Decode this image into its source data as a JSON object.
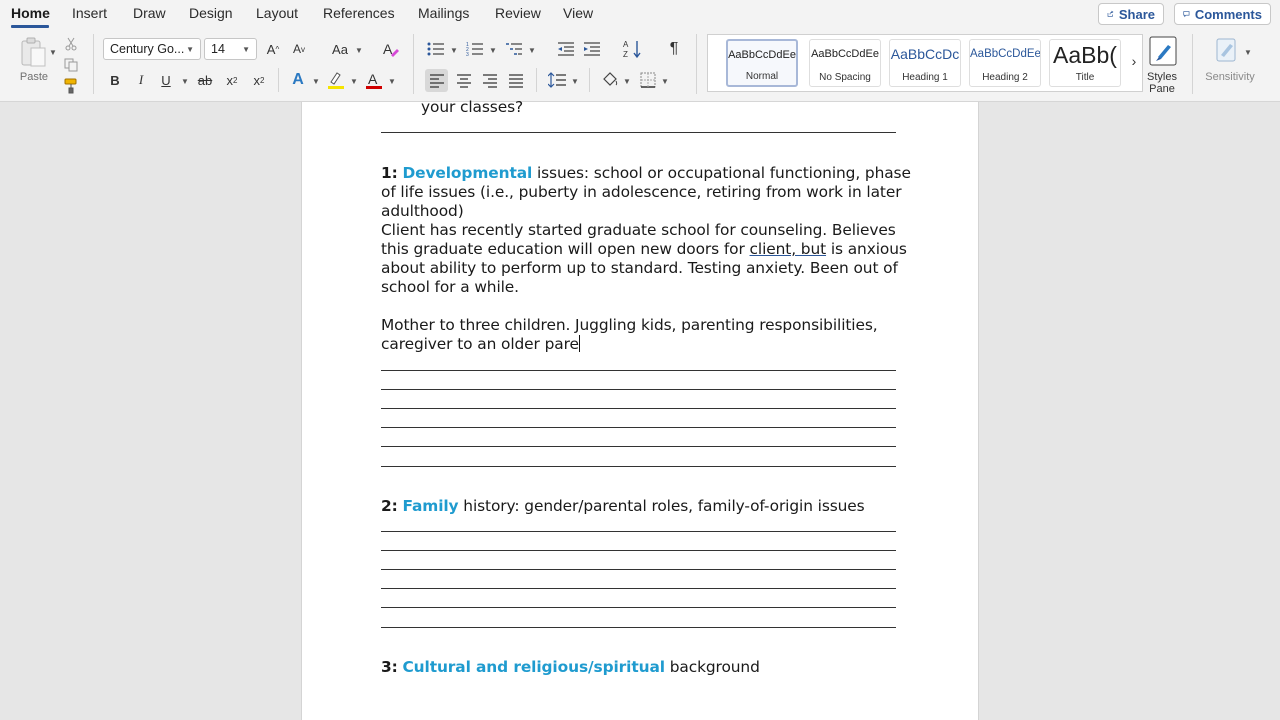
{
  "ribbon": {
    "tabs": [
      "Home",
      "Insert",
      "Draw",
      "Design",
      "Layout",
      "References",
      "Mailings",
      "Review",
      "View"
    ],
    "share_label": "Share",
    "comments_label": "Comments",
    "paste_label": "Paste",
    "font_name": "Century Go...",
    "font_size": "14",
    "styles": [
      {
        "sample": "AaBbCcDdEe",
        "name": "Normal"
      },
      {
        "sample": "AaBbCcDdEe",
        "name": "No Spacing"
      },
      {
        "sample": "AaBbCcDc",
        "name": "Heading 1"
      },
      {
        "sample": "AaBbCcDdEe",
        "name": "Heading 2"
      },
      {
        "sample": "AaBb(",
        "name": "Title"
      }
    ],
    "styles_pane_label": "Styles\nPane",
    "sensitivity_label": "Sensitivity",
    "accent_color": "#2b579a",
    "highlight_color": "#f5e400",
    "font_color": "#d00000"
  },
  "document": {
    "top_line": "your classes?",
    "s1_num": "1:",
    "s1_title": "Developmental",
    "s1_line1_rest": " issues: school or occupational functioning, phase",
    "s1_line2": "of life issues (i.e., puberty in adolescence, retiring from work in later",
    "s1_line3": "adulthood)",
    "p1_line1": "Client has recently started graduate school for counseling. Believes",
    "p1_line2_a": "this graduate education will open new doors for ",
    "p1_line2_link": "client, but",
    "p1_line2_b": " is anxious",
    "p1_line3": "about ability to perform up to standard. Testing anxiety. Been out of",
    "p1_line4": "school for a while.",
    "p2_line1": "Mother to three children. Juggling kids, parenting responsibilities,",
    "p2_line2": "caregiver to an older pare",
    "s2_num": "2:",
    "s2_title": "Family",
    "s2_rest": " history: gender/parental roles, family-of-origin issues",
    "s3_num": "3:",
    "s3_title": "Cultural and religious/spiritual",
    "s3_rest": " background",
    "heading_color": "#1f9bcf"
  }
}
